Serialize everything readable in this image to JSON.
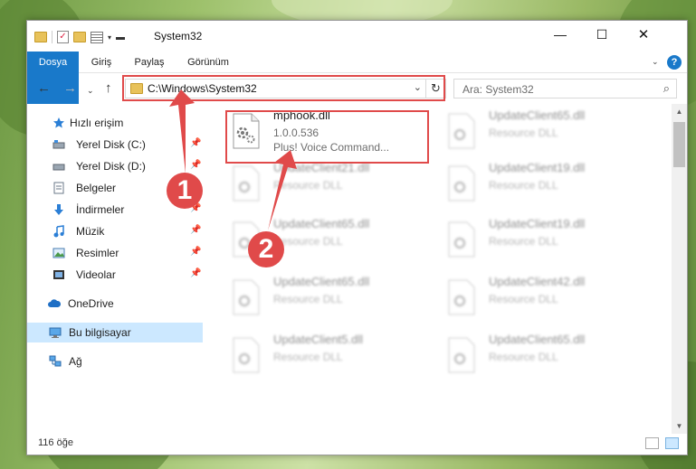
{
  "window": {
    "title": "System32",
    "controls": {
      "minimize": "—",
      "maximize": "☐",
      "close": "✕"
    }
  },
  "ribbon": {
    "tabs": [
      "Dosya",
      "Giriş",
      "Paylaş",
      "Görünüm"
    ],
    "help_label": "?"
  },
  "navigation": {
    "address_path": "C:\\Windows\\System32",
    "search_placeholder": "Ara: System32"
  },
  "sidebar": {
    "items": [
      {
        "label": "Hızlı erişim",
        "icon": "star-icon",
        "pinned": false,
        "selected": false
      },
      {
        "label": "Yerel Disk (C:)",
        "icon": "drive-icon",
        "pinned": true,
        "selected": false
      },
      {
        "label": "Yerel Disk (D:)",
        "icon": "drive-icon",
        "pinned": true,
        "selected": false
      },
      {
        "label": "Belgeler",
        "icon": "documents-icon",
        "pinned": true,
        "selected": false
      },
      {
        "label": "İndirmeler",
        "icon": "download-icon",
        "pinned": true,
        "selected": false
      },
      {
        "label": "Müzik",
        "icon": "music-icon",
        "pinned": true,
        "selected": false
      },
      {
        "label": "Resimler",
        "icon": "pictures-icon",
        "pinned": true,
        "selected": false
      },
      {
        "label": "Videolar",
        "icon": "videos-icon",
        "pinned": true,
        "selected": false
      },
      {
        "label": "OneDrive",
        "icon": "cloud-icon",
        "pinned": false,
        "selected": false
      },
      {
        "label": "Bu bilgisayar",
        "icon": "computer-icon",
        "pinned": false,
        "selected": true
      },
      {
        "label": "Ağ",
        "icon": "network-icon",
        "pinned": false,
        "selected": false
      }
    ]
  },
  "files": {
    "highlighted": {
      "name": "mphook.dll",
      "version": "1.0.0.536",
      "description": "Plus! Voice Command..."
    },
    "blurred": [
      {
        "name": "UpdateClient65.dll",
        "type": "Resource DLL"
      },
      {
        "name": "UpdateClient21.dll",
        "type": "Resource DLL"
      },
      {
        "name": "UpdateClient19.dll",
        "type": "Resource DLL"
      },
      {
        "name": "UpdateClient65.dll",
        "type": "Resource DLL"
      },
      {
        "name": "UpdateClient19.dll",
        "type": "Resource DLL"
      },
      {
        "name": "UpdateClient65.dll",
        "type": "Resource DLL"
      },
      {
        "name": "UpdateClient42.dll",
        "type": "Resource DLL"
      },
      {
        "name": "UpdateClient5.dll",
        "type": "Resource DLL"
      },
      {
        "name": "UpdateClient65.dll",
        "type": "Resource DLL"
      }
    ]
  },
  "status": {
    "item_count": "116 öğe"
  },
  "annotations": {
    "step1": "1",
    "step2": "2",
    "color": "#e04a4a"
  },
  "colors": {
    "accent": "#1979ca",
    "selection": "#cce8ff"
  }
}
